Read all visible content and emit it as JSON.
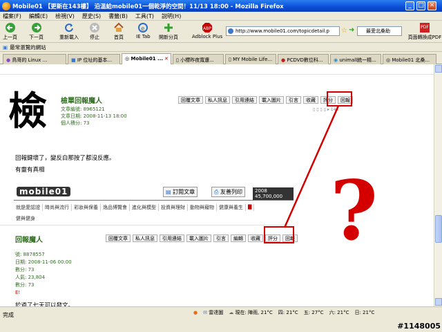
{
  "window": {
    "title": "Mobile01 【更新在143樓】 沿溫給mobile01一個乾淨的空間！11/13 18:00 - Mozilla Firefox",
    "minimize": "_",
    "maximize": "□",
    "close": "✕"
  },
  "menu": [
    "檔案(F)",
    "編輯(E)",
    "檢視(V)",
    "歷史(S)",
    "書籤(B)",
    "工具(T)",
    "說明(H)"
  ],
  "toolbar": {
    "back": "上一頁",
    "forward": "下一頁",
    "reload": "重新載入",
    "stop": "停止",
    "home": "首頁",
    "ietab": "IE Tab",
    "newtab": "開新分頁",
    "adblock": "Adblock Plus",
    "url": "http://www.mobile01.com/topicdetail.p",
    "search": "最愛北桑助",
    "pdf": "頁面轉換成PDF"
  },
  "bookmarks": {
    "label": "最常瀏覽的網站"
  },
  "tabs": [
    {
      "label": "鳥哥的 Linux ..."
    },
    {
      "label": "IP 位址的基本..."
    },
    {
      "label": "Mobile01 ...",
      "active": true
    },
    {
      "label": "小櫻昨夜寬遭..."
    },
    {
      "label": "MY Mobile Life..."
    },
    {
      "label": "PCDVD數位科..."
    },
    {
      "label": "unimall統一精..."
    },
    {
      "label": "Mobile01 北桑..."
    }
  ],
  "post1": {
    "avatar_text": "檢",
    "username": "檢單回報魔人",
    "posts": "文章編號: 8965121",
    "date": "文章日期: 2008-11-13 18:00",
    "points": "個人積分: 73",
    "buttons": [
      "回覆文章",
      "私人訊息",
      "引用連結",
      "載入圖片",
      "引言",
      "收藏",
      "評分",
      "回報"
    ],
    "pager": "▯ ▯ ▯ ▯ ▸ 143",
    "body1": "回報鍵壞了，變反白那按了都沒反應。",
    "body2": "有靈有真相"
  },
  "mobilebar": {
    "logo": "mobile01",
    "feed": "訂閱文章",
    "print": "友善列印",
    "count": "2008 45,700,000"
  },
  "nav": [
    "就是愛認證",
    "時尚與流行",
    "彩妝與保養",
    "逸品博覽會",
    "進化與模型",
    "投資與理財",
    "動物與寵物",
    "健康與養生",
    "▇"
  ],
  "nav2": "健與健身",
  "post2": {
    "username": "回報魔人",
    "buttons": [
      "回覆文章",
      "私人訊息",
      "引用連結",
      "載入圖片",
      "引言",
      "編輯",
      "收藏",
      "評分",
      "回報"
    ],
    "meta": [
      "號: 8878557",
      "日期: 2008-11-06 00:00",
      "數分: 73",
      "人氣: 23,804",
      "數分: 73",
      "E!"
    ],
    "body": "於過了七天可以發文。"
  },
  "annotation": "?",
  "status": {
    "done": "完成",
    "mail": "雷達圖",
    "weather_now": "現在: 陣雨, 21°C",
    "w1": "四: 21°C",
    "w2": "五: 27°C",
    "w3": "六: 21°C",
    "w4": "日: 21°C"
  },
  "watermark": "#1148005",
  "colors": {
    "accent": "#0a4ed8",
    "username": "#2f6e1e",
    "highlight": "#d40000"
  }
}
